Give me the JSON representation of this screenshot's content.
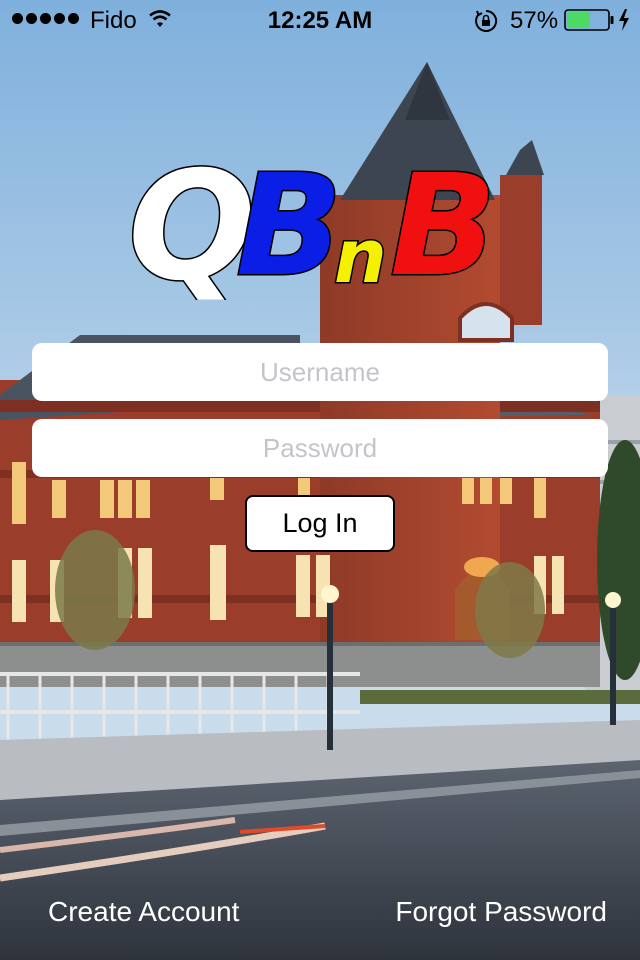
{
  "status_bar": {
    "carrier": "Fido",
    "time": "12:25 AM",
    "battery_percent": "57%",
    "battery_level": 0.57
  },
  "logo": {
    "letters": [
      "Q",
      "B",
      "n",
      "B"
    ],
    "colors": [
      "#ffffff",
      "#0a1ee6",
      "#f5f000",
      "#f01010"
    ]
  },
  "login_form": {
    "username_placeholder": "Username",
    "password_placeholder": "Password",
    "login_label": "Log In"
  },
  "footer": {
    "create_account_label": "Create Account",
    "forgot_password_label": "Forgot Password"
  },
  "colors": {
    "sky": "#8fb8dc",
    "brick": "#9a3d2a",
    "battery_fill": "#4cd964"
  }
}
